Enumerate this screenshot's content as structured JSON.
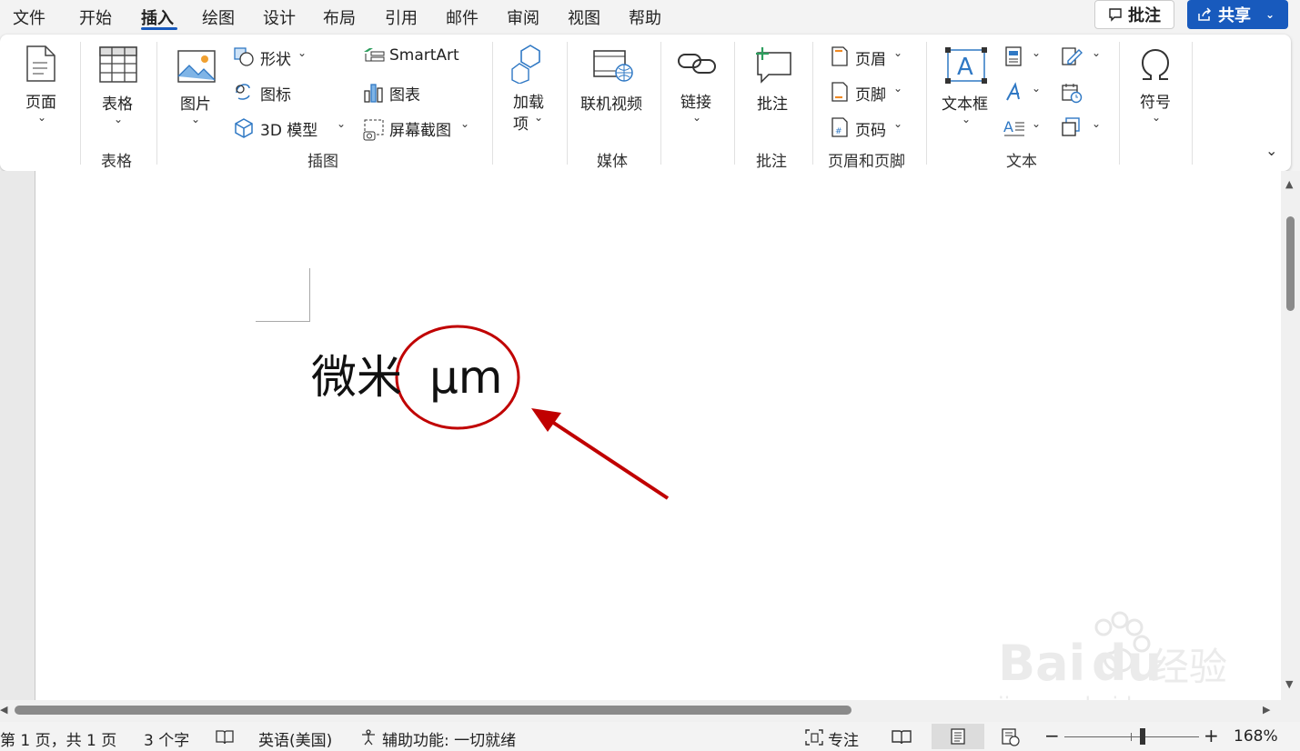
{
  "menu": {
    "tabs": [
      "文件",
      "开始",
      "插入",
      "绘图",
      "设计",
      "布局",
      "引用",
      "邮件",
      "审阅",
      "视图",
      "帮助"
    ],
    "active_tab": "插入",
    "comment_button": "批注",
    "share_button": "共享"
  },
  "ribbon": {
    "page_label": "页面",
    "table_label": "表格",
    "table_group": "表格",
    "picture_label": "图片",
    "shapes_label": "形状",
    "icons_label": "图标",
    "model3d_label": "3D 模型",
    "smartart_label": "SmartArt",
    "chart_label": "图表",
    "screenshot_label": "屏幕截图",
    "illustrations_group": "插图",
    "addins_label_1": "加载",
    "addins_label_2": "项",
    "online_video_label": "联机视频",
    "media_group": "媒体",
    "link_label": "链接",
    "comment_label": "批注",
    "comment_group": "批注",
    "header_label": "页眉",
    "footer_label": "页脚",
    "page_number_label": "页码",
    "header_footer_group": "页眉和页脚",
    "textbox_label": "文本框",
    "text_group": "文本",
    "symbol_label": "符号"
  },
  "document": {
    "text_cn": "微米",
    "text_unit": "µm"
  },
  "status": {
    "page": "第 1 页，共 1 页",
    "words": "3 个字",
    "language": "英语(美国)",
    "accessibility": "辅助功能: 一切就绪",
    "focus": "专注",
    "zoom": "168%"
  },
  "watermark": {
    "brand": "Bai",
    "brand2": "du",
    "cn": "经验",
    "url": "jingyan.baidu.com"
  },
  "colors": {
    "accent": "#185abd",
    "annotation": "#c00000"
  }
}
